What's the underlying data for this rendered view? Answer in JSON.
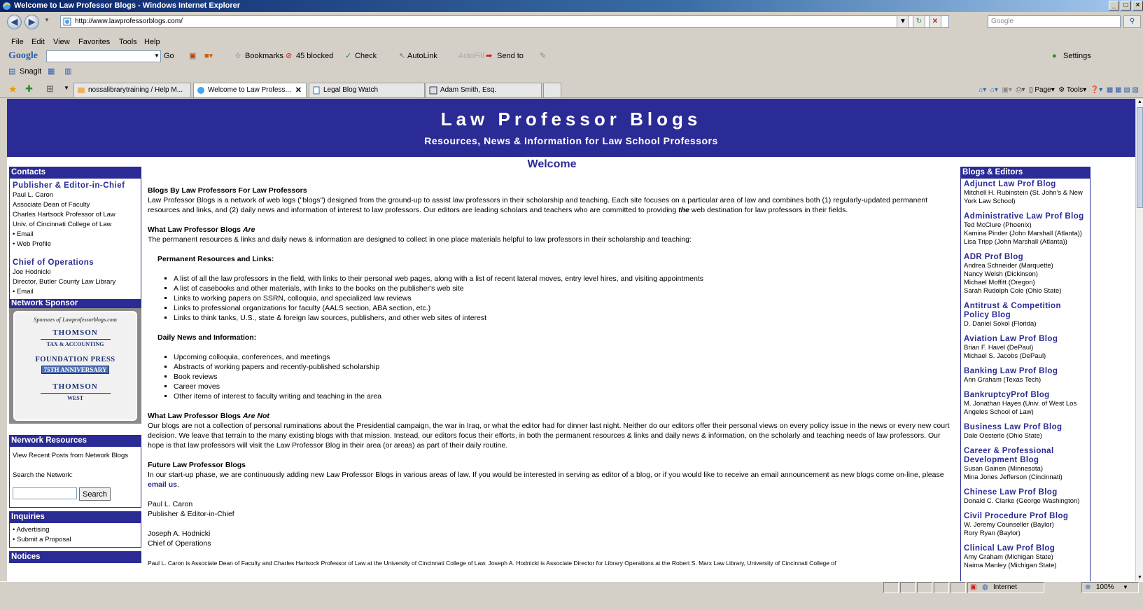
{
  "window": {
    "title": "Welcome to Law Professor Blogs - Windows Internet Explorer"
  },
  "address": {
    "url": "http://www.lawprofessorblogs.com/",
    "search_placeholder": "Google"
  },
  "menu": [
    "File",
    "Edit",
    "View",
    "Favorites",
    "Tools",
    "Help"
  ],
  "google_toolbar": {
    "logo": "Google",
    "go": "Go",
    "bookmarks": "Bookmarks",
    "blocked": "45 blocked",
    "check": "Check",
    "autolink": "AutoLink",
    "autofill": "AutoFill",
    "sendto": "Send to",
    "settings": "Settings"
  },
  "snagit": "Snagit",
  "tabs": [
    {
      "label": "nossalibrarytraining / Help M..."
    },
    {
      "label": "Welcome to Law Profess...",
      "active": true
    },
    {
      "label": "Legal Blog Watch"
    },
    {
      "label": "Adam Smith, Esq."
    }
  ],
  "command_bar": {
    "page": "Page",
    "tools": "Tools"
  },
  "banner": {
    "title": "Law Professor Blogs",
    "subtitle": "Resources, News & Information for Law School Professors"
  },
  "left": {
    "contacts": {
      "heading": "Contacts",
      "pub_title": "Publisher & Editor-in-Chief",
      "pub_lines": [
        "Paul L. Caron",
        "Associate Dean of Faculty",
        "Charles Hartsock Professor of Law",
        "Univ. of Cincinnati College of Law",
        "• Email",
        "• Web Profile"
      ],
      "ops_title": "Chief of Operations",
      "ops_lines": [
        "Joe Hodnicki",
        "Director, Butler County Law Library",
        "• Email"
      ]
    },
    "sponsor": {
      "heading": "Network Sponsor",
      "caption": "Sponsors of Lawprofessorblogs.com",
      "brand1": "THOMSON",
      "brand1_sub": "TAX & ACCOUNTING",
      "brand2": "FOUNDATION PRESS",
      "brand2_sub": "75TH ANNIVERSARY",
      "brand3": "THOMSON",
      "brand3_sub": "WEST"
    },
    "resources": {
      "heading": "Nerwork Resources",
      "link": "View Recent Posts from Network Blogs",
      "search_label": "Search the Network:",
      "search_button": "Search"
    },
    "inquiries": {
      "heading": "Inquiries",
      "items": [
        "• Advertising",
        "• Submit a Proposal"
      ]
    },
    "notices": {
      "heading": "Notices"
    }
  },
  "center": {
    "welcome": "Welcome",
    "h1": "Blogs By Law Professors For Law Professors",
    "p1_a": "Law Professor Blogs is a network of web logs (\"blogs\") designed from the ground-up to assist law professors in their scholarship and teaching. Each site focuses on a particular area of law and combines both (1) regularly-updated permanent resources and links, and (2) daily news and information of interest to law professors. Our editors are leading scholars and teachers who are committed to providing ",
    "p1_em": "the",
    "p1_b": " web destination for law professors in their fields.",
    "h2_a": "What Law Professor Blogs ",
    "h2_em": "Are",
    "p2": "The permanent resources & links and daily news & information are designed to collect in one place materials helpful to law professors in their scholarship and teaching:",
    "perm_title": "Permanent Resources and Links:",
    "perm_items": [
      "A list of all the law professors in the field, with links to their personal web pages, along with a list of recent lateral moves, entry level hires, and visiting appointments",
      "A list of casebooks and other materials, with links to the books on the publisher's web site",
      "Links to working papers on SSRN, colloquia, and specialized law reviews",
      "Links to professional organizations for faculty (AALS section, ABA section, etc.)",
      "Links to think tanks, U.S., state & foreign law sources, publishers, and other web sites of interest"
    ],
    "daily_title": "Daily News and Information:",
    "daily_items": [
      "Upcoming colloquia, conferences, and meetings",
      "Abstracts of working papers and recently-published scholarship",
      "Book reviews",
      "Career moves",
      "Other items of interest to faculty writing and teaching in the area"
    ],
    "h3_a": "What Law Professor Blogs ",
    "h3_em": "Are Not",
    "p3": "Our blogs are not a collection of personal ruminations about the Presidential campaign, the war in Iraq, or what the editor had for dinner last night. Neither do our editors offer their personal views on every policy issue in the news or every new court decision. We leave that terrain to the many existing blogs with that mission. Instead, our editors focus their efforts, in both the permanent resources & links and daily news & information, on the scholarly and teaching needs of law professors. Our hope is that law professors will visit the Law Professor Blog in their area (or areas) as part of their daily routine.",
    "h4": "Future Law Professor Blogs",
    "p4_a": "In our start-up phase, we are continuously adding new Law Professor Blogs in various areas of law. If you would be interested in serving as editor of a blog, or if you would like to receive an email announcement as new blogs come on-line, please ",
    "p4_link": "email us",
    "p4_b": ".",
    "sig1_name": "Paul L. Caron",
    "sig1_title": "Publisher & Editor-in-Chief",
    "sig2_name": "Joseph A. Hodnicki",
    "sig2_title": "Chief of Operations",
    "footer": "Paul L. Caron is Associate Dean of Faculty and Charles Hartsock Professor of Law at the University of Cincinnati College of Law. Joseph A. Hodnicki is Associate Director for Library Operations at the Robert S. Marx Law Library, University of Cincinnati College of"
  },
  "right": {
    "heading": "Blogs & Editors",
    "blogs": [
      {
        "title": "Adjunct Law Prof Blog",
        "editors": [
          "Mitchell H. Rubinstein (St. John's & New York Law School)"
        ]
      },
      {
        "title": "Administrative Law Prof Blog",
        "editors": [
          "Ted McClure (Phoenix)",
          "Kamina Pinder (John Marshall (Atlanta))",
          "Lisa Tripp (John Marshall (Atlanta))"
        ]
      },
      {
        "title": "ADR Prof Blog",
        "editors": [
          "Andrea Schneider (Marquette)",
          "Nancy Welsh (Dickinson)",
          "Michael Moffitt (Oregon)",
          "Sarah Rudolph Cole (Ohio State)"
        ]
      },
      {
        "title": "Antitrust & Competition Policy Blog",
        "editors": [
          "D. Daniel Sokol (Florida)"
        ]
      },
      {
        "title": "Aviation Law Prof Blog",
        "editors": [
          "Brian F. Havel (DePaul)",
          "Michael S. Jacobs (DePaul)"
        ]
      },
      {
        "title": "Banking Law Prof Blog",
        "editors": [
          "Ann Graham (Texas Tech)"
        ]
      },
      {
        "title": "BankruptcyProf Blog",
        "editors": [
          "M. Jonathan Hayes (Univ. of West Los Angeles School of Law)"
        ]
      },
      {
        "title": "Business Law Prof Blog",
        "editors": [
          "Dale Oesterle (Ohio State)"
        ]
      },
      {
        "title": "Career & Professional Development Blog",
        "editors": [
          "Susan Gainen (Minnesota)",
          "Mina Jones Jefferson (Cincinnati)"
        ]
      },
      {
        "title": "Chinese Law Prof Blog",
        "editors": [
          "Donald C. Clarke (George Washington)"
        ]
      },
      {
        "title": "Civil Procedure Prof Blog",
        "editors": [
          "W. Jeremy Counseller (Baylor)",
          "Rory Ryan (Baylor)"
        ]
      },
      {
        "title": "Clinical Law Prof Blog",
        "editors": [
          "Amy Graham (Michigan State)",
          "Naima Manley (Michigan State)"
        ]
      }
    ]
  },
  "status": {
    "zone": "Internet",
    "zoom": "100%"
  }
}
